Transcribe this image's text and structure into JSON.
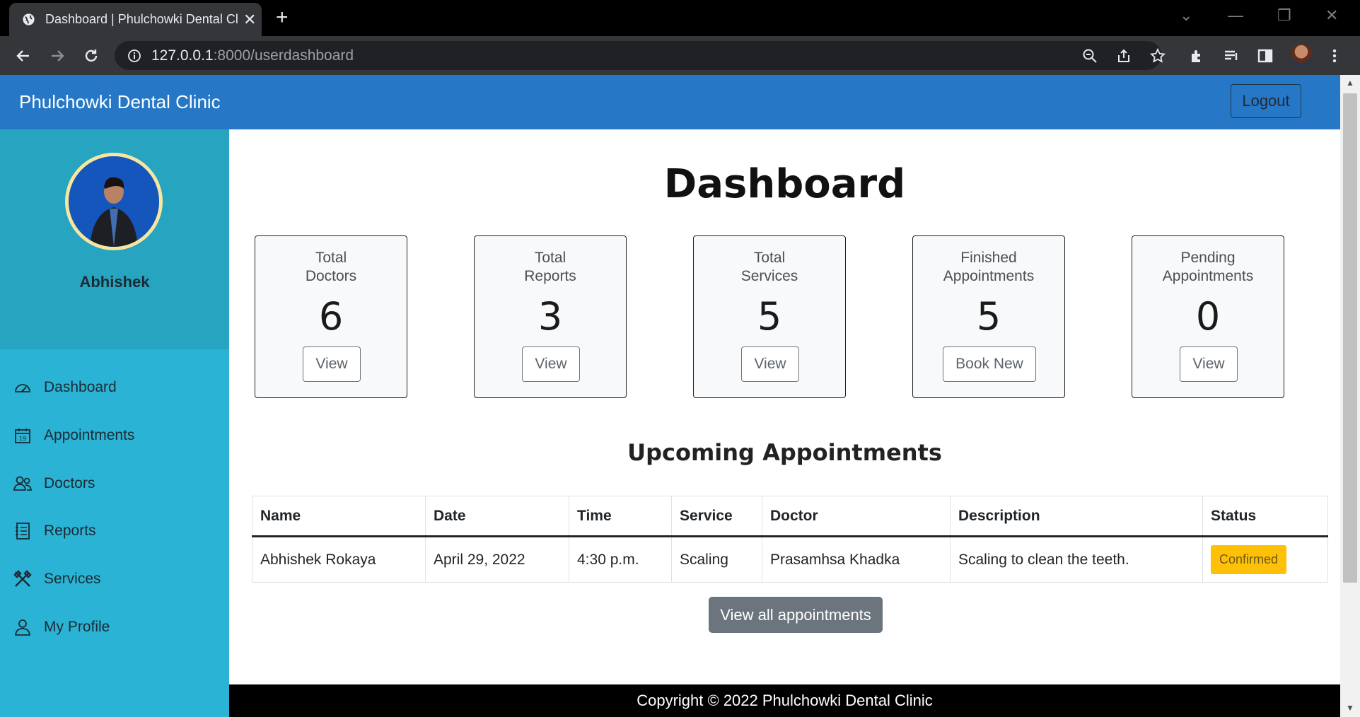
{
  "browser": {
    "tab_title": "Dashboard | Phulchowki Dental Clinic",
    "url_host": "127.0.0.1",
    "url_path": ":8000/userdashboard"
  },
  "navbar": {
    "brand": "Phulchowki Dental Clinic",
    "logout_label": "Logout"
  },
  "sidebar": {
    "username": "Abhishek",
    "items": [
      {
        "label": "Dashboard",
        "icon": "speedometer-icon"
      },
      {
        "label": "Appointments",
        "icon": "calendar-icon"
      },
      {
        "label": "Doctors",
        "icon": "people-icon"
      },
      {
        "label": "Reports",
        "icon": "report-icon"
      },
      {
        "label": "Services",
        "icon": "tools-icon"
      },
      {
        "label": "My Profile",
        "icon": "person-icon"
      }
    ]
  },
  "main": {
    "title": "Dashboard",
    "cards": [
      {
        "title_line1": "Total",
        "title_line2": "Doctors",
        "value": "6",
        "button": "View"
      },
      {
        "title_line1": "Total",
        "title_line2": "Reports",
        "value": "3",
        "button": "View"
      },
      {
        "title_line1": "Total",
        "title_line2": "Services",
        "value": "5",
        "button": "View"
      },
      {
        "title_line1": "Finished",
        "title_line2": "Appointments",
        "value": "5",
        "button": "Book New"
      },
      {
        "title_line1": "Pending",
        "title_line2": "Appointments",
        "value": "0",
        "button": "View"
      }
    ],
    "upcoming_title": "Upcoming Appointments",
    "table": {
      "headers": [
        "Name",
        "Date",
        "Time",
        "Service",
        "Doctor",
        "Description",
        "Status"
      ],
      "rows": [
        [
          "Abhishek Rokaya",
          "April 29, 2022",
          "4:30 p.m.",
          "Scaling",
          "Prasamhsa Khadka",
          "Scaling to clean the teeth.",
          "Confirmed"
        ]
      ]
    },
    "view_all_label": "View all appointments"
  },
  "footer": {
    "text": "Copyright © 2022 Phulchowki Dental Clinic"
  },
  "colors": {
    "navbar": "#2677c6",
    "sidebar": "#2ab3d4",
    "sidebar_top": "#27a4bf",
    "badge": "#ffc107",
    "secondary_button": "#6c757d"
  }
}
